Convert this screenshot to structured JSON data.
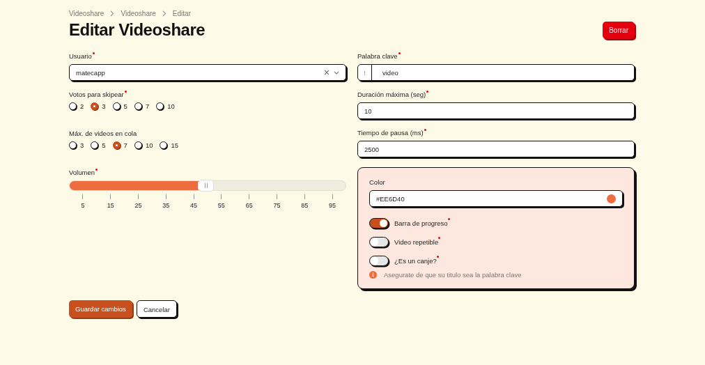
{
  "breadcrumbs": [
    "Videoshare",
    "Videoshare",
    "Editar"
  ],
  "title": "Editar Videoshare",
  "delete_button": "Borrar",
  "left": [
    {
      "kind": "select",
      "label": "Usuario",
      "required": true,
      "value": "matecapp"
    },
    {
      "kind": "radio",
      "label": "Votos para skipear",
      "required": true,
      "options": [
        {
          "label": "2",
          "selected": false
        },
        {
          "label": "3",
          "selected": true
        },
        {
          "label": "5",
          "selected": false
        },
        {
          "label": "7",
          "selected": false
        },
        {
          "label": "10",
          "selected": false
        }
      ]
    },
    {
      "kind": "radio",
      "label": "Máx. de videos en cola",
      "options": [
        {
          "label": "3",
          "selected": false
        },
        {
          "label": "5",
          "selected": false
        },
        {
          "label": "7",
          "selected": true
        },
        {
          "label": "10",
          "selected": false
        },
        {
          "label": "15",
          "selected": false
        }
      ]
    },
    {
      "kind": "slider",
      "label": "Volumen",
      "required": true,
      "level": 0.495,
      "ticks": [
        "5",
        "15",
        "25",
        "35",
        "45",
        "55",
        "65",
        "75",
        "85",
        "95"
      ]
    }
  ],
  "right": [
    {
      "kind": "prefixed",
      "label": "Palabra clave",
      "required": true,
      "prefix": "!",
      "value": "video"
    },
    {
      "kind": "text",
      "label": "Duración máxima (seg)",
      "required": true,
      "value": "10"
    },
    {
      "kind": "text",
      "label": "Tiempo de pausa (ms)",
      "required": true,
      "value": "2500"
    }
  ],
  "panel": {
    "color_label": "Color",
    "color_value": "#EE6D40",
    "color": "#ee6d40",
    "toggles": [
      {
        "label": "Barra de progreso",
        "required": true,
        "on": true
      },
      {
        "label": "Video repetible",
        "required": true,
        "on": false
      },
      {
        "label": "¿Es un canje?",
        "required": true,
        "on": false
      }
    ],
    "hint": "Asegurate de que su titulo sea la palabra clave"
  },
  "buttons": [
    {
      "kind": "primary",
      "label": "Guardar cambios"
    },
    {
      "kind": "secondary",
      "label": "Cancelar"
    }
  ]
}
